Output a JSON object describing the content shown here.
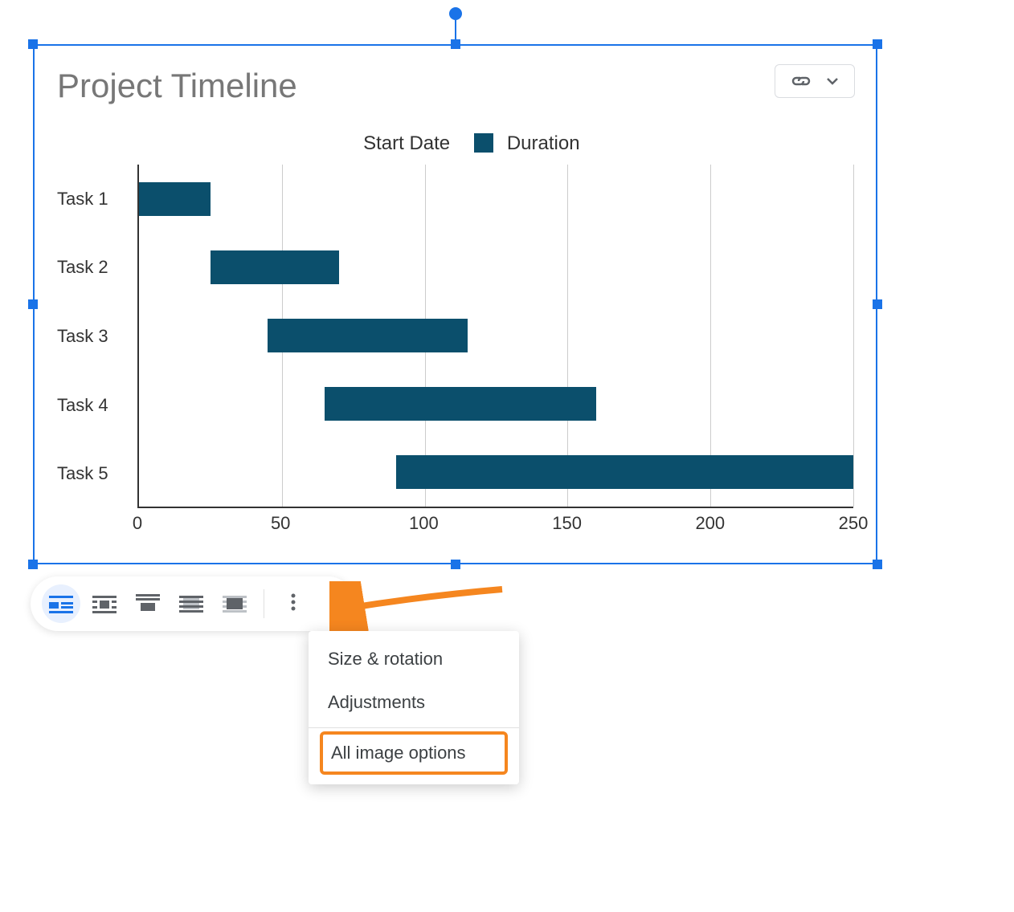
{
  "colors": {
    "selection": "#1a73e8",
    "bar": "#0b4f6c",
    "annotation": "#f5861f"
  },
  "chart_data": {
    "type": "bar",
    "orientation": "horizontal",
    "stacked": true,
    "title": "Project Timeline",
    "categories": [
      "Task 1",
      "Task 2",
      "Task 3",
      "Task 4",
      "Task 5"
    ],
    "series": [
      {
        "name": "Start Date",
        "values": [
          0,
          25,
          45,
          65,
          90
        ],
        "color": "transparent"
      },
      {
        "name": "Duration",
        "values": [
          25,
          45,
          70,
          95,
          160
        ],
        "color": "#0b4f6c"
      }
    ],
    "xlim": [
      0,
      250
    ],
    "xticks": [
      0,
      50,
      100,
      150,
      200,
      250
    ],
    "xlabel": "",
    "ylabel": ""
  },
  "legend": {
    "items": [
      {
        "label": "Start Date",
        "swatch": "transparent"
      },
      {
        "label": "Duration",
        "swatch": "filled"
      }
    ]
  },
  "link_chip": {
    "icon1": "link-icon",
    "icon2": "chevron-down-icon"
  },
  "toolbar": {
    "buttons": [
      {
        "name": "wrap-inline",
        "active": true
      },
      {
        "name": "wrap-square",
        "active": false
      },
      {
        "name": "wrap-break",
        "active": false
      },
      {
        "name": "wrap-behind",
        "active": false
      },
      {
        "name": "wrap-front",
        "active": false
      }
    ],
    "more_button": "more-options"
  },
  "menu": {
    "items": [
      {
        "label": "Size & rotation",
        "highlighted": false
      },
      {
        "label": "Adjustments",
        "highlighted": false
      }
    ],
    "separator": true,
    "highlighted_item": {
      "label": "All image options"
    }
  }
}
